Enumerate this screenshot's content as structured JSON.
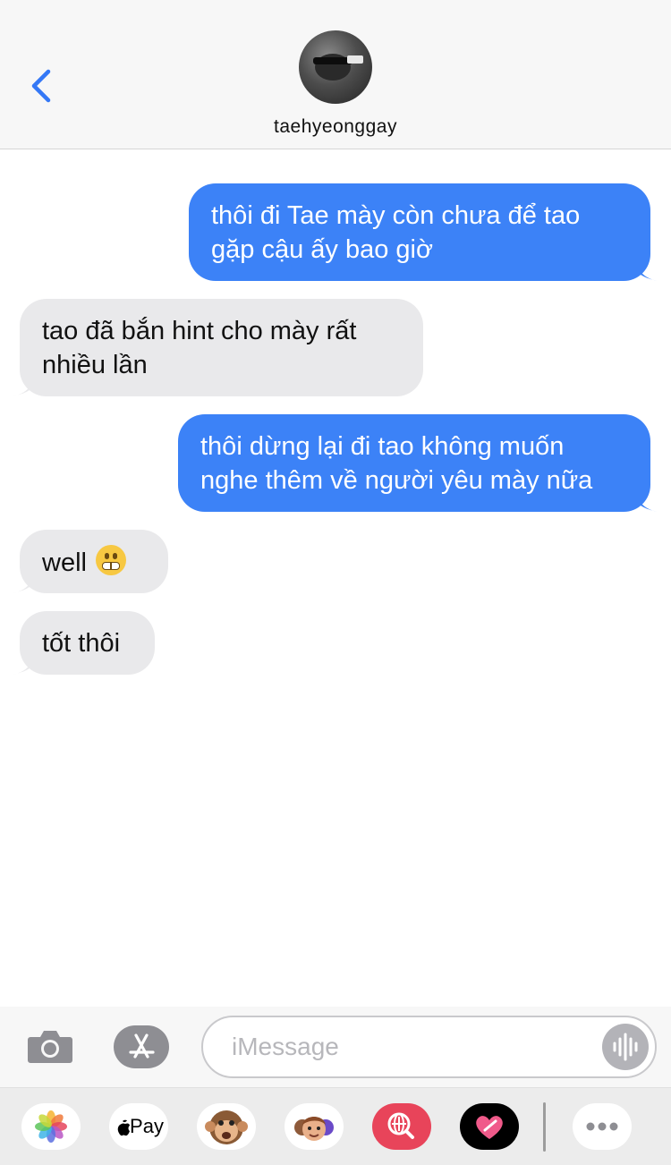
{
  "header": {
    "contact_name": "taehyeonggay",
    "back_icon": "chevron-left-icon",
    "accent_color": "#3478f6"
  },
  "messages": [
    {
      "direction": "sent",
      "lines": [
        "thôi đi Tae mày còn chưa để tao",
        "gặp cậu ấy bao giờ"
      ]
    },
    {
      "direction": "received",
      "lines": [
        "tao đã bắn hint cho mày rất",
        "nhiều lần"
      ]
    },
    {
      "direction": "sent",
      "lines": [
        "thôi dừng lại đi tao không muốn",
        "nghe thêm về người yêu mày nữa"
      ]
    },
    {
      "direction": "received",
      "text": "well",
      "emoji": "grimacing-face-emoji"
    },
    {
      "direction": "received",
      "text": "tốt thôi"
    }
  ],
  "colors": {
    "sent_bubble": "#3c82f7",
    "received_bubble": "#e9e9eb"
  },
  "input": {
    "placeholder": "iMessage",
    "camera_icon": "camera-icon",
    "appstore_icon": "app-store-icon",
    "audio_icon": "audio-waveform-icon"
  },
  "app_drawer": {
    "apps": [
      "photos-icon",
      "apple-pay",
      "animoji-monkey-icon",
      "memoji-stickers-icon",
      "web-images-search-icon",
      "digital-touch-heart-icon",
      "more-icon"
    ],
    "apple_pay_label": "Pay"
  }
}
